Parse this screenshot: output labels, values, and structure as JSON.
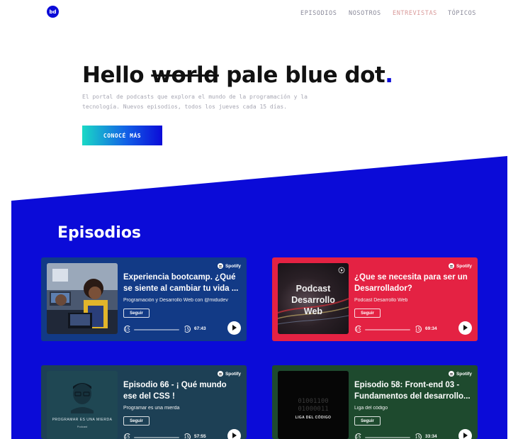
{
  "logo": {
    "text": "bd"
  },
  "nav": {
    "items": [
      {
        "label": "EPISODIOS"
      },
      {
        "label": "NOSOTROS"
      },
      {
        "label": "ENTREVISTAS"
      },
      {
        "label": "TÓPICOS"
      }
    ]
  },
  "hero": {
    "title_start": "Hello ",
    "title_strike": "world",
    "title_end": " pale blue dot",
    "title_dot": ".",
    "subtitle": "El portal de podcasts que explora el mundo de la programación y la tecnología. Nuevos episodios, todos los jueves cada 15 días.",
    "cta_label": "CONOCÉ MÁS"
  },
  "colors": {
    "brand_blue": "#0b0bd8",
    "card1_bg": "#123a86",
    "card2_bg": "#e42243",
    "card3_bg": "#1d4055",
    "card4_bg": "#1e4a2e"
  },
  "episodes": {
    "section_title": "Episodios",
    "cards": [
      {
        "title": "Experiencia bootcamp. ¿Qué se siente al cambiar tu vida ...",
        "show": "Programación y Desarrollo Web con @midudev",
        "follow_label": "Seguir",
        "spotify_label": "Spotify",
        "back_label": "15",
        "fwd_label": "15",
        "duration": "67:43",
        "thumb_text": ""
      },
      {
        "title": "¿Que se necesita para ser un Desarrollador?",
        "show": "Podcast Desarrollo Web",
        "follow_label": "Seguir",
        "spotify_label": "Spotify",
        "back_label": "15",
        "fwd_label": "15",
        "duration": "69:34",
        "thumb_text": "Podcast Desarrollo Web"
      },
      {
        "title": "Episodio 66 - ¡ Qué mundo ese del CSS !",
        "show": "Programar es una mierda",
        "follow_label": "Seguir",
        "spotify_label": "Spotify",
        "back_label": "15",
        "fwd_label": "15",
        "duration": "57:55",
        "thumb_text": "PROGRAMAR ES UNA MIERDA",
        "thumb_subtext": "Podcast"
      },
      {
        "title": "Episodio 58: Front-end 03 - Fundamentos del desarrollo...",
        "show": "Liga del código",
        "follow_label": "Seguir",
        "spotify_label": "Spotify",
        "back_label": "15",
        "fwd_label": "15",
        "duration": "33:34",
        "thumb_text": "LIGA DEL CÓDIGO",
        "thumb_binary": "01001100 01000011"
      }
    ]
  }
}
